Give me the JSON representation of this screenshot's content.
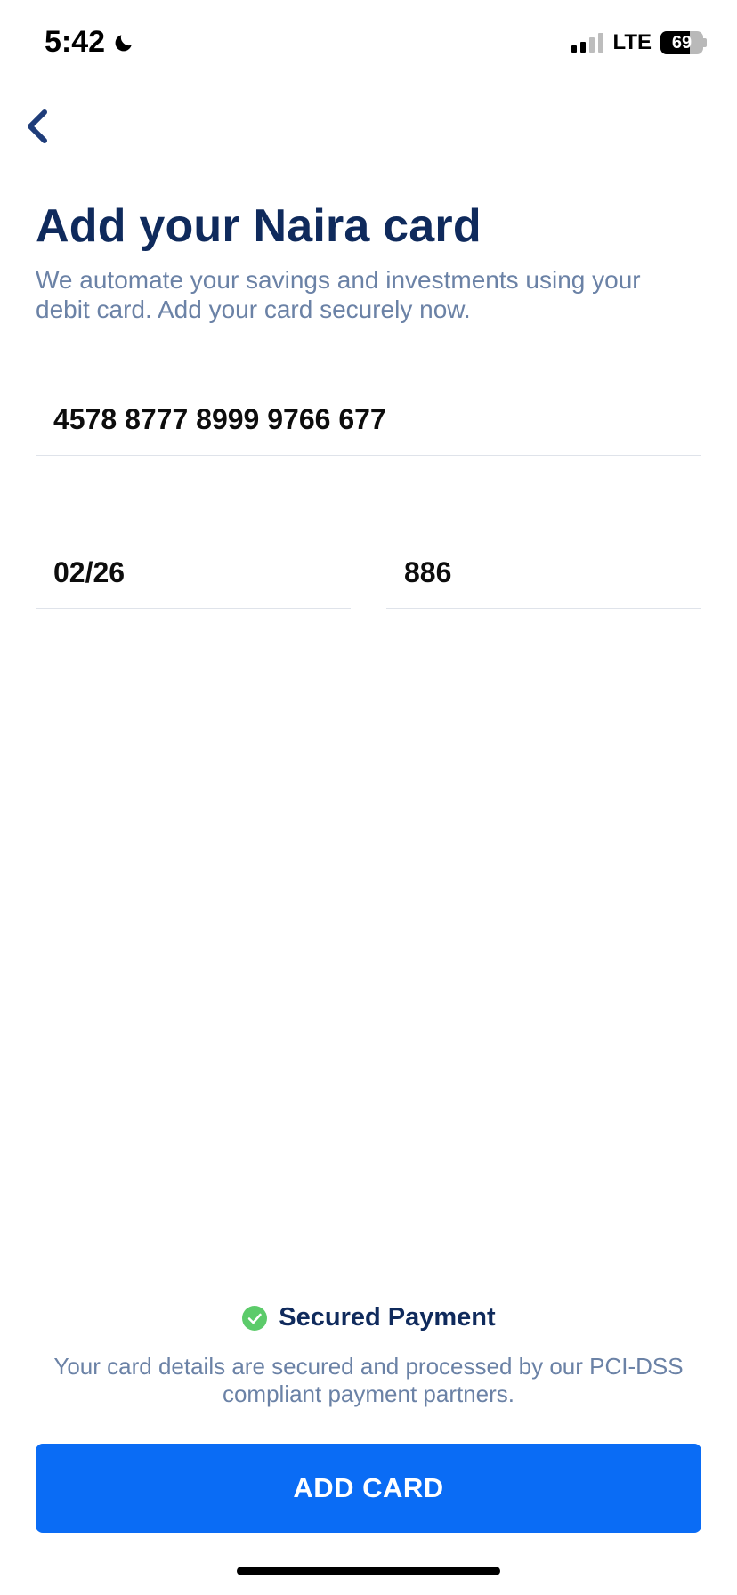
{
  "status_bar": {
    "time": "5:42",
    "network": "LTE",
    "battery_percent": "69",
    "battery_level": 0.69,
    "signal_bars_active": 2,
    "signal_bars_total": 4
  },
  "header": {
    "title": "Add your Naira card",
    "subtitle": "We automate your savings and investments using your debit card. Add your card securely now."
  },
  "form": {
    "card_number": "4578 8777 8999 9766 677",
    "expiry": "02/26",
    "cvv": "886"
  },
  "security": {
    "label": "Secured Payment",
    "note": "Your card details are secured and processed by our PCI-DSS compliant payment partners."
  },
  "actions": {
    "add_card_label": "ADD CARD"
  },
  "colors": {
    "primary": "#0a6cf5",
    "heading": "#0f2a5c",
    "muted": "#6b82a6",
    "success": "#5ccb6a"
  }
}
